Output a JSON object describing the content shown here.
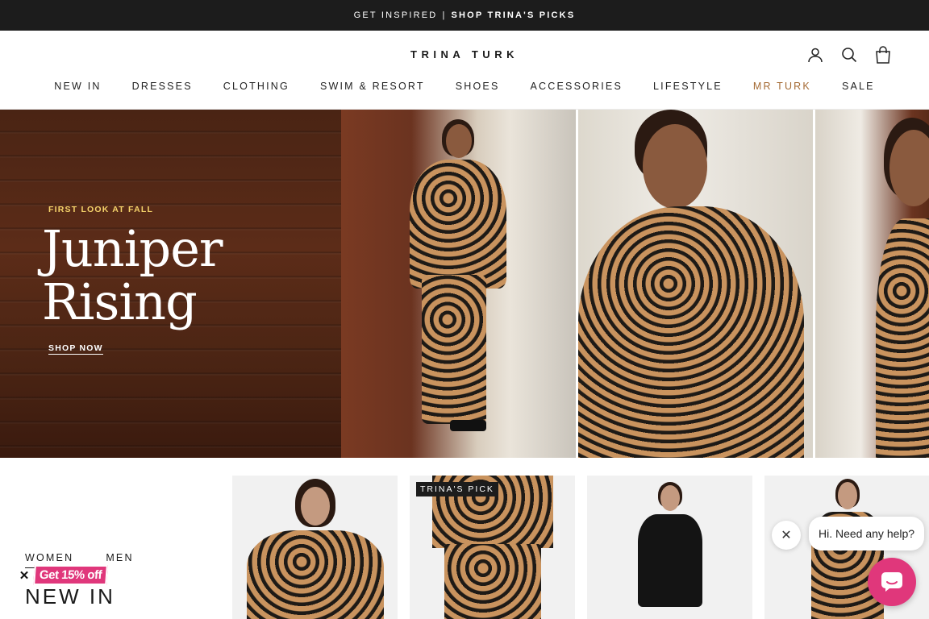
{
  "announcement": {
    "prefix": "GET INSPIRED",
    "separator": "|",
    "link": "SHOP TRINA'S PICKS"
  },
  "header": {
    "logo": "TRINA TURK",
    "icons": [
      "account-icon",
      "search-icon",
      "bag-icon"
    ]
  },
  "nav": {
    "items": [
      {
        "label": "NEW IN"
      },
      {
        "label": "DRESSES"
      },
      {
        "label": "CLOTHING"
      },
      {
        "label": "SWIM & RESORT"
      },
      {
        "label": "SHOES"
      },
      {
        "label": "ACCESSORIES"
      },
      {
        "label": "LIFESTYLE"
      },
      {
        "label": "MR TURK"
      },
      {
        "label": "SALE"
      }
    ],
    "accent_color": "#a46a33"
  },
  "hero": {
    "eyebrow": "FIRST LOOK AT FALL",
    "title_line1": "Juniper",
    "title_line2": "Rising",
    "cta": "SHOP NOW",
    "eyebrow_color": "#f5d36b"
  },
  "collection": {
    "tabs": [
      {
        "label": "WOMEN"
      },
      {
        "label": "MEN"
      }
    ],
    "title": "NEW IN",
    "products": [
      {
        "badge": ""
      },
      {
        "badge": "TRINA'S PICK"
      },
      {
        "badge": ""
      },
      {
        "badge": ""
      }
    ]
  },
  "promo": {
    "close": "✕",
    "label": "Get 15% off",
    "color": "#e0377b"
  },
  "chat": {
    "close": "✕",
    "message": "Hi. Need any help?",
    "button_color": "#e0377b"
  }
}
